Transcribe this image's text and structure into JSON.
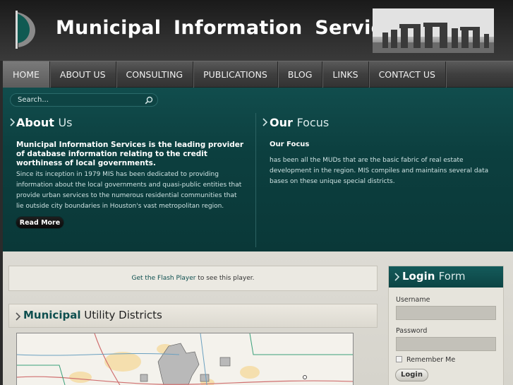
{
  "header": {
    "title": "Municipal  Information  Services"
  },
  "nav": {
    "items": [
      {
        "label": "HOME",
        "active": true
      },
      {
        "label": "ABOUT US",
        "active": false
      },
      {
        "label": "CONSULTING",
        "active": false
      },
      {
        "label": "PUBLICATIONS",
        "active": false
      },
      {
        "label": "BLOG",
        "active": false
      },
      {
        "label": "LINKS",
        "active": false
      },
      {
        "label": "CONTACT US",
        "active": false
      }
    ]
  },
  "search": {
    "placeholder": "Search..."
  },
  "about": {
    "heading_bold": "About",
    "heading_light": "Us",
    "subheading": "Municipal Information Services is the leading provider of database information relating to the credit worthiness of local governments.",
    "body": "Since its inception in 1979 MIS has been dedicated to providing information about the local governments and quasi-public entities that provide urban services to the numerous residential communities that lie outside city boundaries in Houston's vast metropolitan region.",
    "button_label": "Read More"
  },
  "focus": {
    "heading_bold": "Our",
    "heading_light": "Focus",
    "subheading": "Our Focus",
    "body": "has been all the MUDs that are the basic fabric of real estate development in the region. MIS compiles and maintains several data bases on these unique special districts."
  },
  "flash": {
    "link_text": "Get the Flash Player",
    "suffix": " to see this player."
  },
  "districts": {
    "heading_bold": "Municipal",
    "heading_light": "Utility Districts"
  },
  "login": {
    "heading_bold": "Login",
    "heading_light": "Form",
    "username_label": "Username",
    "password_label": "Password",
    "remember_label": "Remember Me",
    "button_label": "Login"
  },
  "colors": {
    "teal": "#0c3f3f",
    "teal_accent": "#0e4f4f",
    "header_bg": "#2e2e2e",
    "lower_bg": "#d6d4cc"
  }
}
